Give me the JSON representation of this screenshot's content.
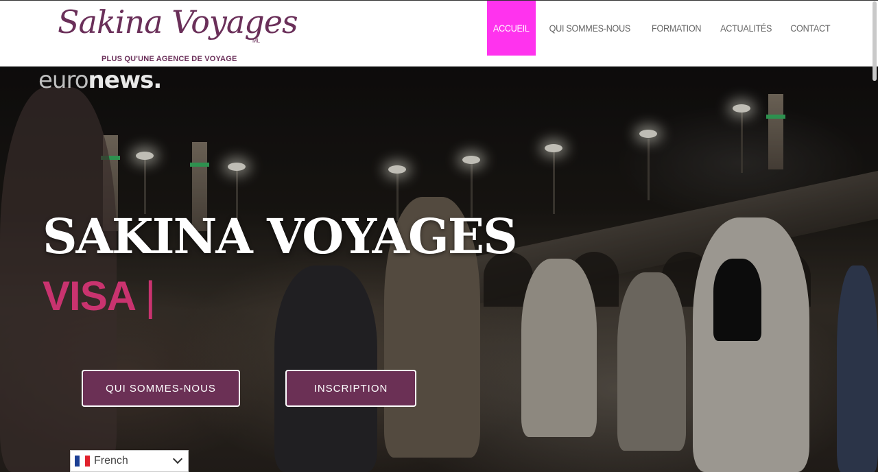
{
  "header": {
    "logo_name": "Sakina Voyages",
    "logo_suffix": "ML",
    "logo_tagline": "PLUS  QU'UNE AGENCE DE VOYAGE",
    "nav": [
      {
        "label": "ACCUEIL",
        "active": true
      },
      {
        "label": "QUI SOMMES-NOUS",
        "active": false
      },
      {
        "label": "FORMATION",
        "active": false
      },
      {
        "label": "ACTUALITÉS",
        "active": false
      },
      {
        "label": "CONTACT",
        "active": false
      }
    ]
  },
  "hero": {
    "watermark_light": "euro",
    "watermark_bold": "news.",
    "title": "SAKINA VOYAGES",
    "subtitle": "VISA ",
    "cursor": "|",
    "buttons": {
      "primary": "QUI SOMMES-NOUS",
      "secondary": "INSCRIPTION"
    }
  },
  "language_selector": {
    "selected": "French",
    "flag_icon": "france-flag-icon"
  },
  "colors": {
    "brand": "#6a2f59",
    "nav_active": "#ff33ee",
    "accent": "#c9336f",
    "button_bg": "#6b3055"
  }
}
